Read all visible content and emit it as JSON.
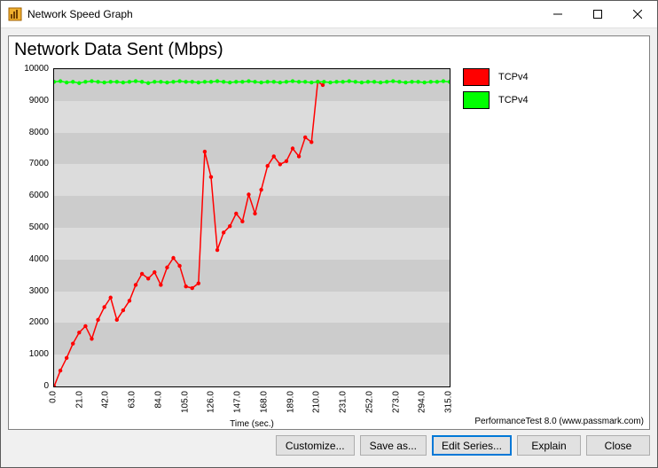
{
  "window": {
    "title": "Network Speed Graph"
  },
  "chart": {
    "title": "Network Data Sent (Mbps)",
    "xlabel": "Time (sec.)",
    "credits": "PerformanceTest 8.0 (www.passmark.com)"
  },
  "legend": {
    "items": [
      {
        "name": "TCPv4",
        "color": "#ff0000"
      },
      {
        "name": "TCPv4",
        "color": "#00ff00"
      }
    ]
  },
  "buttons": {
    "customize": "Customize...",
    "save_as": "Save as...",
    "edit_series": "Edit Series...",
    "explain": "Explain",
    "close": "Close"
  },
  "y_ticks": [
    0,
    1000,
    2000,
    3000,
    4000,
    5000,
    6000,
    7000,
    8000,
    9000,
    10000
  ],
  "x_ticks": [
    "0.0",
    "21.0",
    "42.0",
    "63.0",
    "84.0",
    "105.0",
    "126.0",
    "147.0",
    "168.0",
    "189.0",
    "210.0",
    "231.0",
    "252.0",
    "273.0",
    "294.0",
    "315.0"
  ],
  "chart_data": {
    "type": "line",
    "xlabel": "Time (sec.)",
    "ylabel": "",
    "title": "Network Data Sent (Mbps)",
    "xlim": [
      0,
      315
    ],
    "ylim": [
      0,
      10000
    ],
    "series": [
      {
        "name": "TCPv4",
        "color": "#ff0000",
        "x": [
          0,
          5,
          10,
          15,
          20,
          25,
          30,
          35,
          40,
          45,
          50,
          55,
          60,
          65,
          70,
          75,
          80,
          85,
          90,
          95,
          100,
          105,
          110,
          115,
          120,
          125,
          130,
          135,
          140,
          145,
          150,
          155,
          160,
          165,
          170,
          175,
          180,
          185,
          190,
          195,
          200,
          205,
          210,
          214
        ],
        "y": [
          0,
          500,
          900,
          1350,
          1700,
          1900,
          1500,
          2100,
          2500,
          2800,
          2100,
          2400,
          2700,
          3200,
          3550,
          3400,
          3600,
          3200,
          3750,
          4050,
          3800,
          3150,
          3100,
          3250,
          7400,
          6600,
          4300,
          4850,
          5050,
          5450,
          5200,
          6050,
          5450,
          6200,
          6950,
          7250,
          7000,
          7100,
          7500,
          7250,
          7850,
          7700,
          9600,
          9500
        ]
      },
      {
        "name": "TCPv4",
        "color": "#00ff00",
        "x": [
          0,
          5,
          10,
          15,
          20,
          25,
          30,
          35,
          40,
          45,
          50,
          55,
          60,
          65,
          70,
          75,
          80,
          85,
          90,
          95,
          100,
          105,
          110,
          115,
          120,
          125,
          130,
          135,
          140,
          145,
          150,
          155,
          160,
          165,
          170,
          175,
          180,
          185,
          190,
          195,
          200,
          205,
          210,
          215,
          220,
          225,
          230,
          235,
          240,
          245,
          250,
          255,
          260,
          265,
          270,
          275,
          280,
          285,
          290,
          295,
          300,
          305,
          310,
          315
        ],
        "y": [
          9600,
          9620,
          9580,
          9600,
          9560,
          9600,
          9620,
          9600,
          9580,
          9600,
          9600,
          9580,
          9600,
          9620,
          9600,
          9560,
          9600,
          9600,
          9580,
          9600,
          9620,
          9600,
          9600,
          9580,
          9600,
          9600,
          9620,
          9600,
          9580,
          9600,
          9600,
          9620,
          9600,
          9580,
          9600,
          9600,
          9580,
          9600,
          9620,
          9600,
          9600,
          9580,
          9600,
          9600,
          9580,
          9600,
          9600,
          9620,
          9600,
          9580,
          9600,
          9600,
          9580,
          9600,
          9620,
          9600,
          9580,
          9600,
          9600,
          9580,
          9600,
          9600,
          9620,
          9600
        ]
      }
    ]
  }
}
